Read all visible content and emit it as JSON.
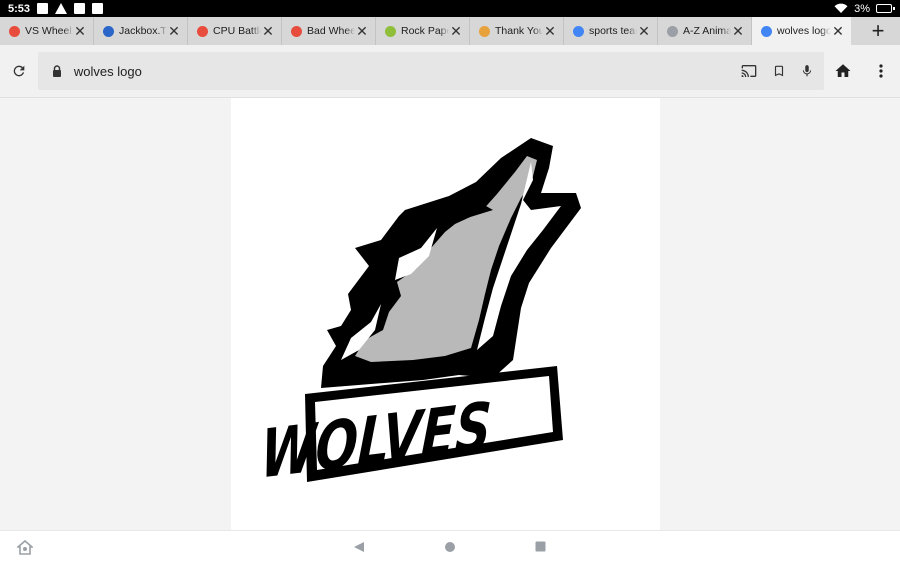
{
  "status_bar": {
    "time": "5:53",
    "battery": "3%",
    "icons": [
      "image-icon",
      "warning-icon",
      "gmail-icon",
      "square-icon",
      "wifi-icon",
      "battery-icon"
    ]
  },
  "tabs": [
    {
      "label": "VS Wheel",
      "favicon": "#e84c3d",
      "active": false
    },
    {
      "label": "Jackbox.TV",
      "favicon": "#2a66c9",
      "active": false
    },
    {
      "label": "CPU Battle",
      "favicon": "#e84c3d",
      "active": false
    },
    {
      "label": "Bad Wheel",
      "favicon": "#e84c3d",
      "active": false
    },
    {
      "label": "Rock Paper",
      "favicon": "#8fbf3a",
      "active": false
    },
    {
      "label": "Thank You!",
      "favicon": "#e8a23b",
      "active": false
    },
    {
      "label": "sports team",
      "favicon": "#4285f4",
      "active": false
    },
    {
      "label": "A-Z Animal",
      "favicon": "#9aa0a6",
      "active": false
    },
    {
      "label": "wolves logo",
      "favicon": "#4285f4",
      "active": true
    }
  ],
  "toolbar": {
    "url": "wolves logo"
  },
  "logo": {
    "text": "WOLVES"
  }
}
